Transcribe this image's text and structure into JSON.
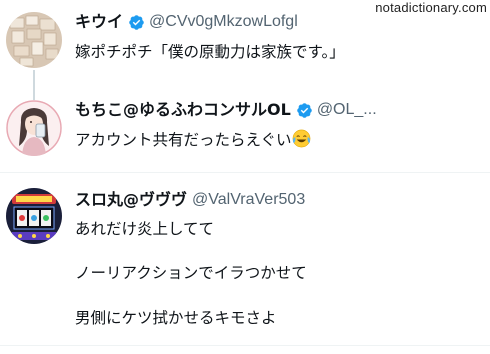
{
  "watermark": "notadictionary.com",
  "tweets": [
    {
      "name": "キウイ",
      "handle": "@CVv0gMkzowLofgl",
      "text": "嫁ポチポチ「僕の原動力は家族です。」"
    },
    {
      "name": "もちこ@ゆるふわコンサルOL",
      "handle": "@OL_...",
      "text": "アカウント共有だったらえぐい",
      "emoji": "face-with-tears-of-joy-emoji"
    },
    {
      "name": "スロ丸@ヴヴヴ",
      "handle": "@ValVraVer503",
      "lines": [
        "あれだけ炎上してて",
        "ノーリアクションでイラつかせて",
        "男側にケツ拭かせるキモさよ"
      ]
    }
  ],
  "colors": {
    "verified": "#1d9bf0",
    "handle": "#536471",
    "text": "#0f1419",
    "divider": "#eff3f4",
    "thread_line": "#cfd9de"
  }
}
